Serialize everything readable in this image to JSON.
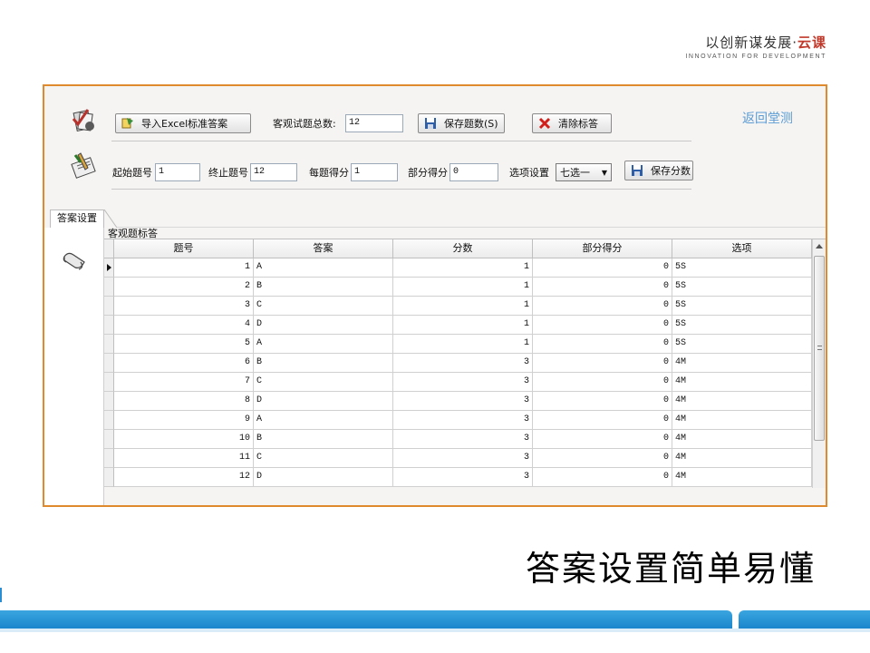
{
  "brand": {
    "cn": "以创新谋发展·",
    "seal": "云课",
    "en": "INNOVATION FOR DEVELOPMENT"
  },
  "toolbar": {
    "import_excel_label": "导入Excel标准答案",
    "total_label": "客观试题总数:",
    "total_value": "12",
    "save_count_label": "保存题数(S)",
    "clear_label": "清除标答",
    "start_label": "起始题号",
    "start_value": "1",
    "end_label": "终止题号",
    "end_value": "12",
    "score_label": "每题得分",
    "score_value": "1",
    "partial_label": "部分得分",
    "partial_value": "0",
    "option_label": "选项设置",
    "option_value": "七选一",
    "save_score_label": "保存分数",
    "return_label": "返回堂测"
  },
  "tabs": {
    "active": "答案设置"
  },
  "grid": {
    "caption": "客观题标答",
    "columns": [
      "题号",
      "答案",
      "分数",
      "部分得分",
      "选项"
    ],
    "rows": [
      [
        "1",
        "A",
        "1",
        "0",
        "5S"
      ],
      [
        "2",
        "B",
        "1",
        "0",
        "5S"
      ],
      [
        "3",
        "C",
        "1",
        "0",
        "5S"
      ],
      [
        "4",
        "D",
        "1",
        "0",
        "5S"
      ],
      [
        "5",
        "A",
        "1",
        "0",
        "5S"
      ],
      [
        "6",
        "B",
        "3",
        "0",
        "4M"
      ],
      [
        "7",
        "C",
        "3",
        "0",
        "4M"
      ],
      [
        "8",
        "D",
        "3",
        "0",
        "4M"
      ],
      [
        "9",
        "A",
        "3",
        "0",
        "4M"
      ],
      [
        "10",
        "B",
        "3",
        "0",
        "4M"
      ],
      [
        "11",
        "C",
        "3",
        "0",
        "4M"
      ],
      [
        "12",
        "D",
        "3",
        "0",
        "4M"
      ]
    ]
  },
  "slide_caption": "答案设置简单易懂",
  "colors": {
    "window_border": "#e08a2e",
    "link": "#5b9bd5",
    "bottom_bar": "#1b86cc"
  },
  "icons": [
    "checklist-icon",
    "edit-sheet-icon",
    "excel-icon",
    "save-icon",
    "clear-x-icon",
    "scroll-icon"
  ]
}
